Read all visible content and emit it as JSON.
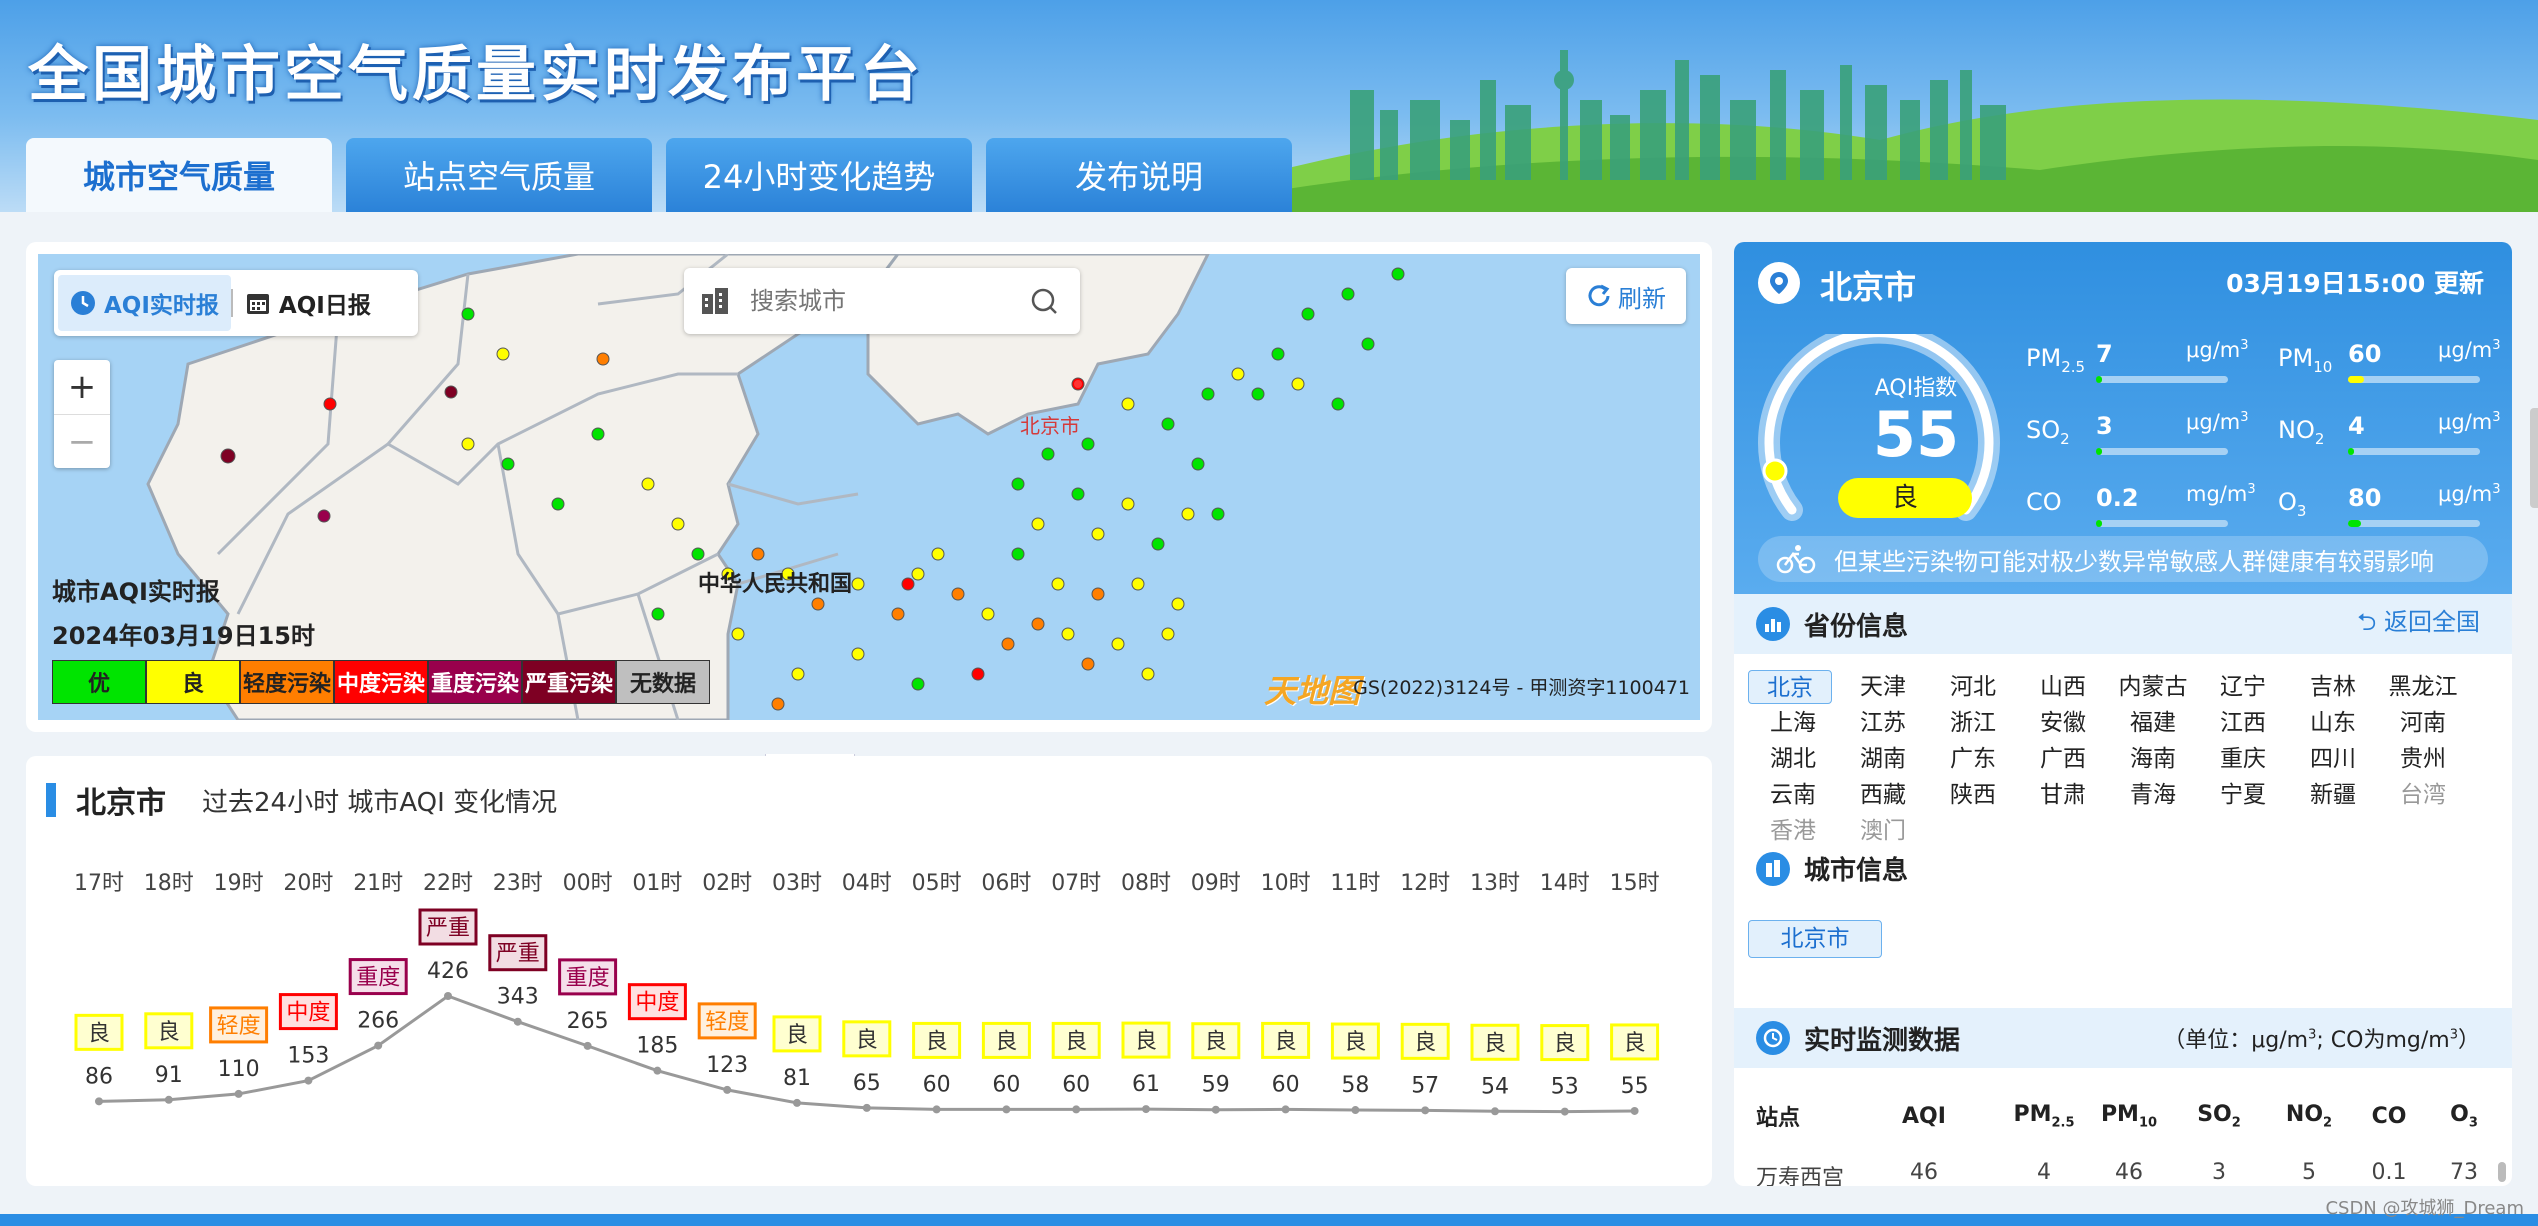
{
  "header": {
    "title": "全国城市空气质量实时发布平台"
  },
  "tabs": [
    {
      "label": "城市空气质量"
    },
    {
      "label": "站点空气质量"
    },
    {
      "label": "24小时变化趋势"
    },
    {
      "label": "发布说明"
    }
  ],
  "map": {
    "aqi_realtime": "AQI实时报",
    "aqi_daily": "AQI日报",
    "search_placeholder": "搜索城市",
    "refresh": "刷新",
    "zoom_in": "+",
    "zoom_out": "−",
    "capital_label": "北京市",
    "country_label": "中华人民共和国",
    "caption_title": "城市AQI实时报",
    "caption_time": "2024年03月19日15时",
    "legend": [
      {
        "label": "优",
        "color": "#00e400",
        "text": "#222"
      },
      {
        "label": "良",
        "color": "#ffff00",
        "text": "#222"
      },
      {
        "label": "轻度污染",
        "color": "#ff7e00",
        "text": "#222"
      },
      {
        "label": "中度污染",
        "color": "#ff0000",
        "text": "#fff"
      },
      {
        "label": "重度污染",
        "color": "#99004c",
        "text": "#fff"
      },
      {
        "label": "严重污染",
        "color": "#7e0023",
        "text": "#fff"
      },
      {
        "label": "无数据",
        "color": "#bfbfbf",
        "text": "#222"
      }
    ],
    "provider_logo": "天地图",
    "copyright": "GS(2022)3124号 - 甲测资字1100471"
  },
  "trend": {
    "city": "北京市",
    "subtitle": "过去24小时 城市AQI 变化情况",
    "hours": [
      "17时",
      "18时",
      "19时",
      "20时",
      "21时",
      "22时",
      "23时",
      "00时",
      "01时",
      "02时",
      "03时",
      "04时",
      "05时",
      "06时",
      "07时",
      "08时",
      "09时",
      "10时",
      "11时",
      "12时",
      "13时",
      "14时",
      "15时"
    ],
    "values": [
      86,
      91,
      110,
      153,
      266,
      426,
      343,
      265,
      185,
      123,
      81,
      65,
      60,
      60,
      60,
      61,
      59,
      60,
      58,
      57,
      54,
      53,
      55
    ],
    "levels": [
      "良",
      "良",
      "轻度",
      "中度",
      "重度",
      "严重",
      "严重",
      "重度",
      "中度",
      "轻度",
      "良",
      "良",
      "良",
      "良",
      "良",
      "良",
      "良",
      "良",
      "良",
      "良",
      "良",
      "良",
      "良"
    ]
  },
  "city_card": {
    "name": "北京市",
    "update_time": "03月19日15:00 更新",
    "aqi_label": "AQI指数",
    "aqi_value": "55",
    "aqi_level": "良",
    "tip": "但某些污染物可能对极少数异常敏感人群健康有较弱影响",
    "pollutants": [
      {
        "name": "PM",
        "sub": "2.5",
        "value": "7",
        "unit": "μg/m",
        "unit_sup": "3",
        "fill": 0.03
      },
      {
        "name": "PM",
        "sub": "10",
        "value": "60",
        "unit": "μg/m",
        "unit_sup": "3",
        "fill": 0.12
      },
      {
        "name": "SO",
        "sub": "2",
        "value": "3",
        "unit": "μg/m",
        "unit_sup": "3",
        "fill": 0.01
      },
      {
        "name": "NO",
        "sub": "2",
        "value": "4",
        "unit": "μg/m",
        "unit_sup": "3",
        "fill": 0.01
      },
      {
        "name": "CO",
        "sub": "",
        "value": "0.2",
        "unit": "mg/m",
        "unit_sup": "3",
        "fill": 0.01
      },
      {
        "name": "O",
        "sub": "3",
        "value": "80",
        "unit": "μg/m",
        "unit_sup": "3",
        "fill": 0.1
      }
    ]
  },
  "province_section": {
    "title": "省份信息",
    "back": "返回全国",
    "provinces": [
      "北京",
      "天津",
      "河北",
      "山西",
      "内蒙古",
      "辽宁",
      "吉林",
      "黑龙江",
      "上海",
      "江苏",
      "浙江",
      "安徽",
      "福建",
      "江西",
      "山东",
      "河南",
      "湖北",
      "湖南",
      "广东",
      "广西",
      "海南",
      "重庆",
      "四川",
      "贵州",
      "云南",
      "西藏",
      "陕西",
      "甘肃",
      "青海",
      "宁夏",
      "新疆",
      "台湾",
      "香港",
      "澳门"
    ]
  },
  "city_section": {
    "title": "城市信息",
    "city": "北京市"
  },
  "monitor_section": {
    "title": "实时监测数据",
    "unit_note_a": "（单位：μg/m",
    "unit_note_b": "; CO为mg/m",
    "unit_note_c": "）",
    "columns": [
      "站点",
      "AQI",
      "PM2.5",
      "PM10",
      "SO2",
      "NO2",
      "CO",
      "O3"
    ],
    "first_row": [
      "万寿西宫",
      "46",
      "4",
      "46",
      "3",
      "5",
      "0.1",
      "73"
    ]
  },
  "watermark": "CSDN @攻城狮_Dream"
}
